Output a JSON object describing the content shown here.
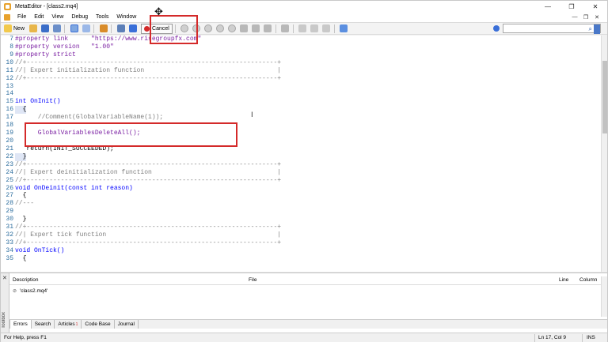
{
  "window": {
    "title": "MetaEditor - [class2.mq4]",
    "controls": [
      "—",
      "❐",
      "✕"
    ]
  },
  "menu": {
    "items": [
      "File",
      "Edit",
      "View",
      "Debug",
      "Tools",
      "Window"
    ],
    "mdi_controls": [
      "—",
      "❐",
      "✕"
    ]
  },
  "toolbar": {
    "new_label": "New",
    "cancel_label": "Cancel"
  },
  "editor": {
    "lines": [
      {
        "n": "7",
        "text": "#property link      \"https://www.risegroupfx.com\""
      },
      {
        "n": "8",
        "text": "#property version   \"1.00\""
      },
      {
        "n": "9",
        "text": "#property strict"
      },
      {
        "n": "10",
        "text": "//+------------------------------------------------------------------+"
      },
      {
        "n": "11",
        "text": "//| Expert initialization function                                   |"
      },
      {
        "n": "12",
        "text": "//+------------------------------------------------------------------+"
      },
      {
        "n": "13",
        "text": ""
      },
      {
        "n": "14",
        "text": ""
      },
      {
        "n": "15",
        "text": "int OnInit()"
      },
      {
        "n": "16",
        "text": "  {"
      },
      {
        "n": "17",
        "text": "      //Comment(GlobalVariableName(1));"
      },
      {
        "n": "18",
        "text": ""
      },
      {
        "n": "19",
        "text": "      GlobalVariablesDeleteAll();"
      },
      {
        "n": "20",
        "text": ""
      },
      {
        "n": "21",
        "text": "   return(INIT_SUCCEEDED);"
      },
      {
        "n": "22",
        "text": "  }"
      },
      {
        "n": "23",
        "text": "//+------------------------------------------------------------------+"
      },
      {
        "n": "24",
        "text": "//| Expert deinitialization function                                 |"
      },
      {
        "n": "25",
        "text": "//+------------------------------------------------------------------+"
      },
      {
        "n": "26",
        "text": "void OnDeinit(const int reason)"
      },
      {
        "n": "27",
        "text": "  {"
      },
      {
        "n": "28",
        "text": "//---"
      },
      {
        "n": "29",
        "text": ""
      },
      {
        "n": "30",
        "text": "  }"
      },
      {
        "n": "31",
        "text": "//+------------------------------------------------------------------+"
      },
      {
        "n": "32",
        "text": "//| Expert tick function                                             |"
      },
      {
        "n": "33",
        "text": "//+------------------------------------------------------------------+"
      },
      {
        "n": "34",
        "text": "void OnTick()"
      },
      {
        "n": "35",
        "text": "  {"
      }
    ]
  },
  "toolbox": {
    "side_label": "Toolbox",
    "columns": {
      "description": "Description",
      "file": "File",
      "line": "Line",
      "column": "Column"
    },
    "rows": [
      {
        "description": "'class2.mq4'"
      }
    ],
    "tabs": [
      "Errors",
      "Search",
      "Articles",
      "Code Base",
      "Journal"
    ],
    "articles_badge": "1"
  },
  "status": {
    "help": "For Help, press F1",
    "position": "Ln 17, Col 9",
    "mode": "INS"
  },
  "colors": {
    "highlight": "#d42a2a",
    "keyword": "#0000ff",
    "preprocessor": "#7a1fa2",
    "comment": "#808080",
    "line_number": "#2f6f9f"
  }
}
